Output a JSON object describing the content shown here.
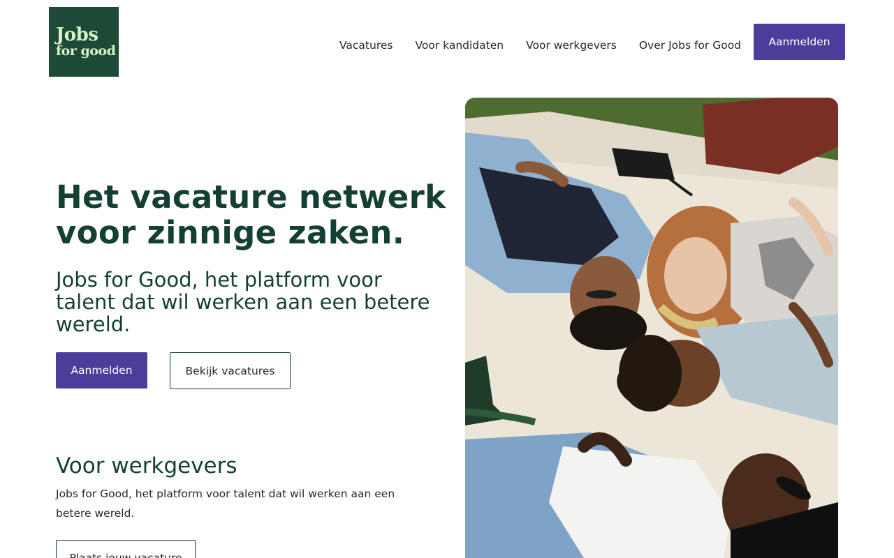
{
  "header": {
    "logo": {
      "line1": "Jobs",
      "line2": "for good"
    },
    "nav": [
      {
        "label": "Vacatures"
      },
      {
        "label": "Voor kandidaten"
      },
      {
        "label": "Voor werkgevers"
      },
      {
        "label": "Over Jobs for Good"
      }
    ],
    "signup_label": "Aanmelden"
  },
  "hero": {
    "title": "Het vacature netwerk voor zinnige zaken.",
    "subtitle": "Jobs for Good, het platform voor talent dat wil werken aan een betere wereld.",
    "primary_button": "Aanmelden",
    "secondary_button": "Bekijk vacatures"
  },
  "employers": {
    "title": "Voor werkgevers",
    "body": "Jobs for Good, het platform voor talent dat wil werken aan een betere wereld.",
    "button": "Plaats jouw vacature"
  },
  "colors": {
    "brand_green": "#1c4a36",
    "logo_text": "#d7f2c7",
    "accent_purple": "#4c3d9b",
    "heading": "#133f35"
  }
}
